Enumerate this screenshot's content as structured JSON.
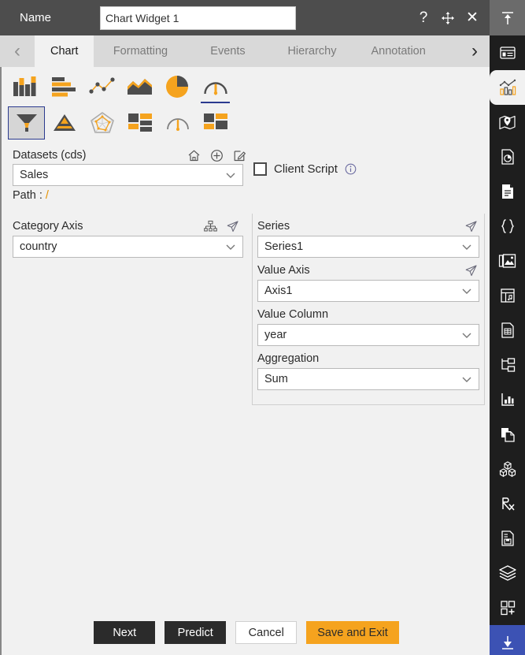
{
  "titlebar": {
    "label": "Name",
    "input_value": "Chart Widget 1",
    "input_placeholder": "",
    "help_icon": "question-mark-icon",
    "move_icon": "move-cross-icon",
    "close_icon": "close-x-icon",
    "help_glyph": "?",
    "move_glyph": "✥",
    "close_glyph": "✕",
    "background": "#4d4d4d"
  },
  "tabs": {
    "prev_glyph": "‹",
    "next_glyph": "›",
    "items": [
      {
        "label": "Chart",
        "active": true
      },
      {
        "label": "Formatting",
        "active": false
      },
      {
        "label": "Events",
        "active": false
      },
      {
        "label": "Hierarchy",
        "active": false
      },
      {
        "label": "Annotation",
        "active": false
      }
    ]
  },
  "chart_types": {
    "row1": [
      {
        "name": "column-chart-icon",
        "selected": false,
        "underlined": false
      },
      {
        "name": "bar-chart-icon",
        "selected": false,
        "underlined": false
      },
      {
        "name": "scatter-line-chart-icon",
        "selected": false,
        "underlined": false
      },
      {
        "name": "area-chart-icon",
        "selected": false,
        "underlined": false
      },
      {
        "name": "pie-chart-icon",
        "selected": false,
        "underlined": false
      },
      {
        "name": "gauge-chart-icon",
        "selected": false,
        "underlined": true
      }
    ],
    "row2": [
      {
        "name": "funnel-chart-icon",
        "selected": true,
        "underlined": false
      },
      {
        "name": "pyramid-chart-icon",
        "selected": false,
        "underlined": false
      },
      {
        "name": "radar-chart-icon",
        "selected": false,
        "underlined": false
      },
      {
        "name": "treemap-chart-icon",
        "selected": false,
        "underlined": false
      },
      {
        "name": "speedometer-chart-icon",
        "selected": false,
        "underlined": false
      },
      {
        "name": "tile-chart-icon",
        "selected": false,
        "underlined": false
      }
    ]
  },
  "datasets": {
    "label": "Datasets (cds)",
    "value": "Sales",
    "path_label": "Path :",
    "path_value": "/",
    "icons": [
      "home-icon",
      "add-circle-icon",
      "edit-pencil-icon"
    ]
  },
  "client_script": {
    "label": "Client Script",
    "checked": false,
    "info_icon": "info-circle-icon"
  },
  "category_axis": {
    "label": "Category Axis",
    "value": "country",
    "icons": [
      "hierarchy-tree-icon",
      "send-arrow-icon"
    ]
  },
  "series": {
    "label": "Series",
    "value": "Series1",
    "icons": [
      "send-arrow-icon"
    ]
  },
  "value_axis": {
    "label": "Value Axis",
    "value": "Axis1",
    "icons": [
      "send-arrow-icon"
    ]
  },
  "value_column": {
    "label": "Value Column",
    "value": "year",
    "icons": []
  },
  "aggregation": {
    "label": "Aggregation",
    "value": "Sum",
    "icons": []
  },
  "buttons": {
    "next": "Next",
    "predict": "Predict",
    "cancel": "Cancel",
    "save_and_exit": "Save and Exit",
    "accent_color": "#f5a31e"
  },
  "right_rail": {
    "top": {
      "name": "collapse-up-icon"
    },
    "items": [
      {
        "name": "widget-panel-icon",
        "active": false
      },
      {
        "name": "chart-widget-icon",
        "active": true
      },
      {
        "name": "map-widget-icon",
        "active": false
      },
      {
        "name": "report-pie-icon",
        "active": false
      },
      {
        "name": "document-icon",
        "active": false
      },
      {
        "name": "json-braces-icon",
        "active": false
      },
      {
        "name": "image-gallery-icon",
        "active": false
      },
      {
        "name": "table-note-icon",
        "active": false
      },
      {
        "name": "form-document-icon",
        "active": false
      },
      {
        "name": "tree-structure-icon",
        "active": false
      },
      {
        "name": "analytics-icon",
        "active": false
      },
      {
        "name": "copy-page-icon",
        "active": false
      },
      {
        "name": "blocks-cubes-icon",
        "active": false
      },
      {
        "name": "prescription-rx-icon",
        "active": false
      },
      {
        "name": "saved-document-icon",
        "active": false
      },
      {
        "name": "layers-icon",
        "active": false
      },
      {
        "name": "add-widget-grid-icon",
        "active": false
      },
      {
        "name": "download-icon",
        "active": false,
        "highlighted": true
      }
    ]
  }
}
